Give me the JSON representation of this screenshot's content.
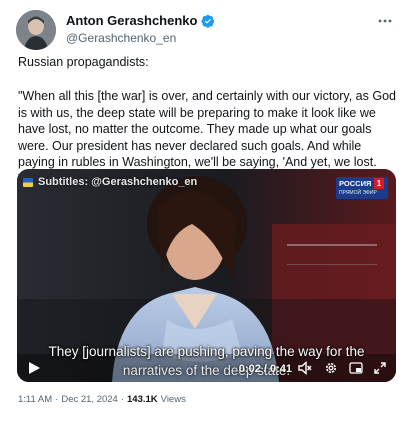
{
  "author": {
    "name": "Anton Gerashchenko",
    "handle": "@Gerashchenko_en",
    "verified": true
  },
  "tweet": {
    "intro": "Russian propagandists:",
    "quote": "\"When all this [the war] is over, and certainly with our victory, as God is with us, the deep state will be preparing to make it look like we have lost, no matter the outcome. They made up what our goals were. Our president has never declared such goals. And while paying in rubles in Washington, we'll be saying, 'And yet, we lost. Too bad we lost.' \""
  },
  "video": {
    "subtitle_credit": "Subtitles: @Gerashchenko_en",
    "channel_name": "РОССИЯ",
    "channel_number": "1",
    "channel_live": "ПРЯМОЙ ЭФИР",
    "caption_line1": "They [journalists] are pushing, paving the way for the",
    "caption_line2": "narratives of the deep state.",
    "time": "0:02 / 0:41",
    "icons": [
      "play-icon",
      "mute-icon",
      "settings-icon",
      "pip-icon",
      "fullscreen-icon"
    ]
  },
  "meta": {
    "time": "1:11 AM",
    "date": "Dec 21, 2024",
    "separator": "·",
    "views_count": "143.1K",
    "views_label": "Views"
  },
  "colors": {
    "verified": "#1d9bf0",
    "secondary_text": "#536471",
    "primary_text": "#0f1419"
  }
}
